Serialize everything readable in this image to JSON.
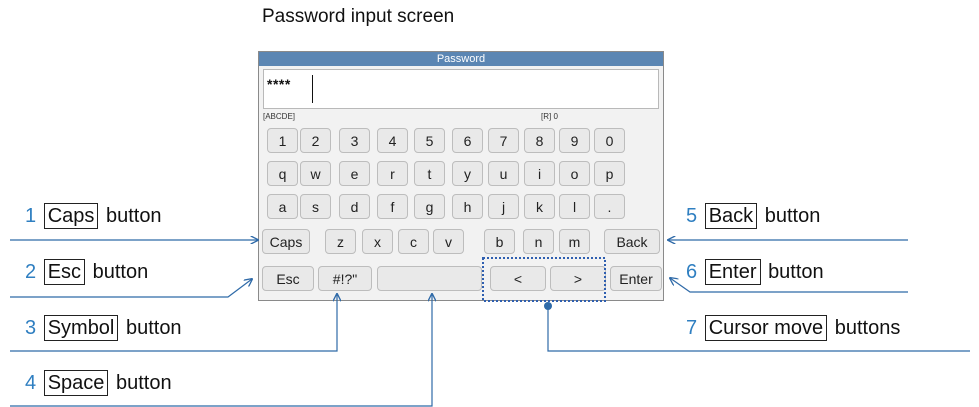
{
  "title": "Password input screen",
  "screen": {
    "titlebar": "Password",
    "value": "****",
    "mode": "[ABCDE]",
    "remaining": "[R]  0"
  },
  "keys": {
    "row1": [
      "1",
      "2",
      "3",
      "4",
      "5",
      "6",
      "7",
      "8",
      "9",
      "0"
    ],
    "row2": [
      "q",
      "w",
      "e",
      "r",
      "t",
      "y",
      "u",
      "i",
      "o",
      "p"
    ],
    "row3": [
      "a",
      "s",
      "d",
      "f",
      "g",
      "h",
      "j",
      "k",
      "l",
      "."
    ],
    "caps": "Caps",
    "row4": [
      "z",
      "x",
      "c",
      "v",
      "b",
      "n",
      "m"
    ],
    "back": "Back",
    "esc": "Esc",
    "symbol": "#!?\"",
    "space": "",
    "cursor_left": "<",
    "cursor_right": ">",
    "enter": "Enter"
  },
  "callouts": [
    {
      "num": "1",
      "label": "Caps",
      "suffix": "button"
    },
    {
      "num": "2",
      "label": "Esc",
      "suffix": "button"
    },
    {
      "num": "3",
      "label": "Symbol",
      "suffix": "button"
    },
    {
      "num": "4",
      "label": "Space",
      "suffix": "button"
    },
    {
      "num": "5",
      "label": "Back",
      "suffix": "button"
    },
    {
      "num": "6",
      "label": "Enter",
      "suffix": "button"
    },
    {
      "num": "7",
      "label": "Cursor move",
      "suffix": "buttons"
    }
  ],
  "colors": {
    "accent_number": "#2f7fc1",
    "leader_line": "#2f6aa8",
    "titlebar": "#5b86b3",
    "cursor_group_outline": "#2f5fb0"
  }
}
